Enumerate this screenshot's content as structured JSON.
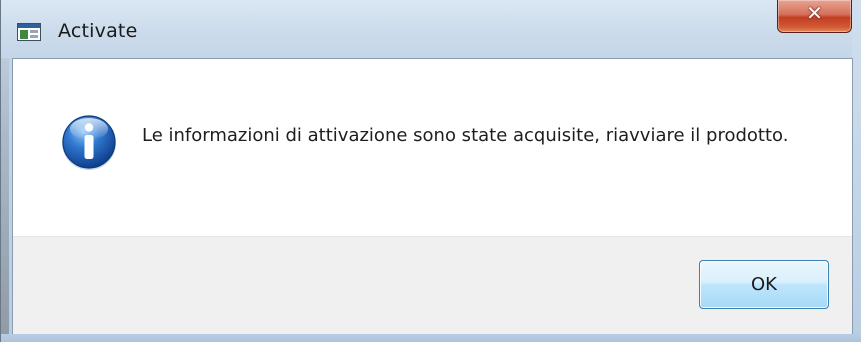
{
  "window": {
    "title": "Activate",
    "app_icon": "application-window-icon",
    "close_icon": "close-icon"
  },
  "dialog": {
    "icon": "info-icon",
    "message": "Le informazioni di attivazione sono state acquisite, riavviare il prodotto.",
    "ok_label": "OK"
  },
  "colors": {
    "close_button": "#c23d22",
    "ok_border": "#3c7fb1",
    "button_area": "#f0f0f0",
    "info_icon": "#1f5fb8"
  }
}
